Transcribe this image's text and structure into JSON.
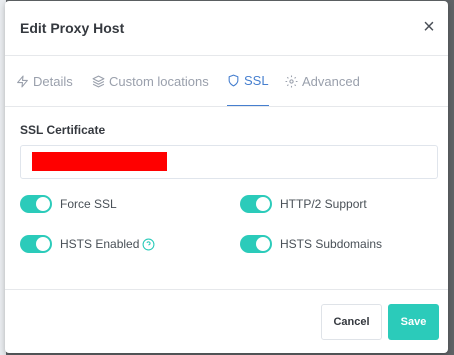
{
  "modal": {
    "title": "Edit Proxy Host",
    "close_symbol": "×"
  },
  "tabs": [
    {
      "label": "Details",
      "icon": "zap-icon",
      "active": false
    },
    {
      "label": "Custom locations",
      "icon": "layers-icon",
      "active": false
    },
    {
      "label": "SSL",
      "icon": "shield-icon",
      "active": true
    },
    {
      "label": "Advanced",
      "icon": "gear-icon",
      "active": false
    }
  ],
  "ssl": {
    "certificate_label": "SSL Certificate",
    "toggles": {
      "force_ssl": {
        "label": "Force SSL",
        "on": true
      },
      "http2": {
        "label": "HTTP/2 Support",
        "on": true
      },
      "hsts": {
        "label": "HSTS Enabled",
        "on": true
      },
      "hsts_subdomains": {
        "label": "HSTS Subdomains",
        "on": true
      }
    }
  },
  "footer": {
    "cancel_label": "Cancel",
    "save_label": "Save"
  },
  "colors": {
    "accent": "#467fcf",
    "toggle_on": "#2bcbba",
    "save_button": "#2bcbba"
  }
}
